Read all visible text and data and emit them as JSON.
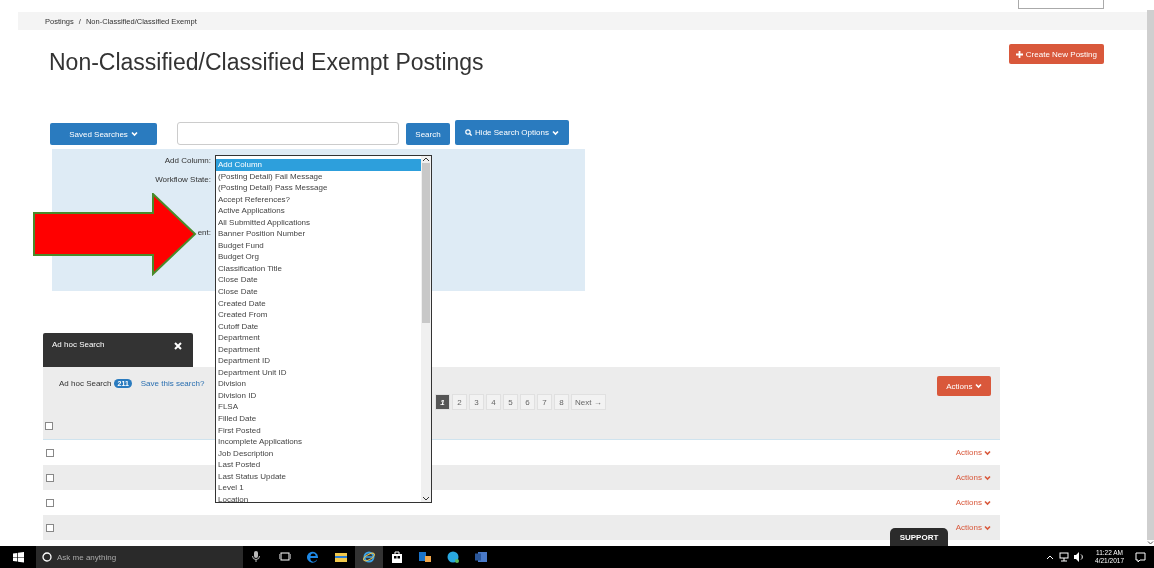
{
  "breadcrumb": {
    "items": [
      {
        "label": "Postings"
      },
      {
        "label": "Non-Classified/Classified Exempt"
      }
    ],
    "separator": "/"
  },
  "title": "Non-Classified/Classified Exempt Postings",
  "create_button": {
    "label": "Create New Posting"
  },
  "toolbar": {
    "saved_searches": "Saved Searches",
    "search_button": "Search",
    "options_button": "Hide Search Options"
  },
  "search_options": {
    "fields": [
      {
        "label": "Add Column:"
      },
      {
        "label": "Workflow State:"
      },
      {
        "label": "ent:"
      }
    ]
  },
  "column_list": {
    "items": [
      {
        "label": "Add Column",
        "selected": true
      },
      {
        "label": "(Posting Detail) Fail Message",
        "selected": false
      },
      {
        "label": "(Posting Detail) Pass Message",
        "selected": false
      },
      {
        "label": "Accept References?",
        "selected": false
      },
      {
        "label": "Active Applications",
        "selected": false
      },
      {
        "label": "All Submitted Applications",
        "selected": false
      },
      {
        "label": "Banner Position Number",
        "selected": false
      },
      {
        "label": "Budget Fund",
        "selected": false
      },
      {
        "label": "Budget Org",
        "selected": false
      },
      {
        "label": "Classification Title",
        "selected": false
      },
      {
        "label": "Close Date",
        "selected": false
      },
      {
        "label": "Close Date",
        "selected": false
      },
      {
        "label": "Created Date",
        "selected": false
      },
      {
        "label": "Created From",
        "selected": false
      },
      {
        "label": "Cutoff Date",
        "selected": false
      },
      {
        "label": "Department",
        "selected": false
      },
      {
        "label": "Department",
        "selected": false
      },
      {
        "label": "Department ID",
        "selected": false
      },
      {
        "label": "Department Unit ID",
        "selected": false
      },
      {
        "label": "Division",
        "selected": false
      },
      {
        "label": "Division ID",
        "selected": false
      },
      {
        "label": "FLSA",
        "selected": false
      },
      {
        "label": "Filled Date",
        "selected": false
      },
      {
        "label": "First Posted",
        "selected": false
      },
      {
        "label": "Incomplete Applications",
        "selected": false
      },
      {
        "label": "Job Description",
        "selected": false
      },
      {
        "label": "Last Posted",
        "selected": false
      },
      {
        "label": "Last Status Update",
        "selected": false
      },
      {
        "label": "Level 1",
        "selected": false
      },
      {
        "label": "Location",
        "selected": false
      }
    ]
  },
  "tab": {
    "title": "Ad hoc Search"
  },
  "results": {
    "label": "Ad hoc Search",
    "count": "211",
    "save_link": "Save this search?",
    "actions": "Actions",
    "pages": [
      {
        "label": "1",
        "selected": true
      },
      {
        "label": "2",
        "selected": false
      },
      {
        "label": "3",
        "selected": false
      },
      {
        "label": "4",
        "selected": false
      },
      {
        "label": "5",
        "selected": false
      },
      {
        "label": "6",
        "selected": false
      },
      {
        "label": "7",
        "selected": false
      },
      {
        "label": "8",
        "selected": false
      }
    ],
    "next": "Next →",
    "header_checked": false,
    "rows": [
      {
        "checked": false,
        "actions": "Actions"
      },
      {
        "checked": false,
        "actions": "Actions"
      },
      {
        "checked": false,
        "actions": "Actions"
      },
      {
        "checked": false,
        "actions": "Actions"
      }
    ]
  },
  "support": "SUPPORT",
  "taskbar": {
    "search_placeholder": "Ask me anything",
    "apps": [
      {
        "kind": "mic",
        "active": false
      },
      {
        "kind": "taskview",
        "active": false
      },
      {
        "kind": "edge",
        "active": false
      },
      {
        "kind": "explorer",
        "active": false
      },
      {
        "kind": "ie",
        "active": true
      },
      {
        "kind": "store",
        "active": false
      },
      {
        "kind": "outlook",
        "active": false
      },
      {
        "kind": "skype",
        "active": false
      },
      {
        "kind": "word",
        "active": false
      }
    ],
    "time": "11:22 AM",
    "date": "4/21/2017"
  }
}
